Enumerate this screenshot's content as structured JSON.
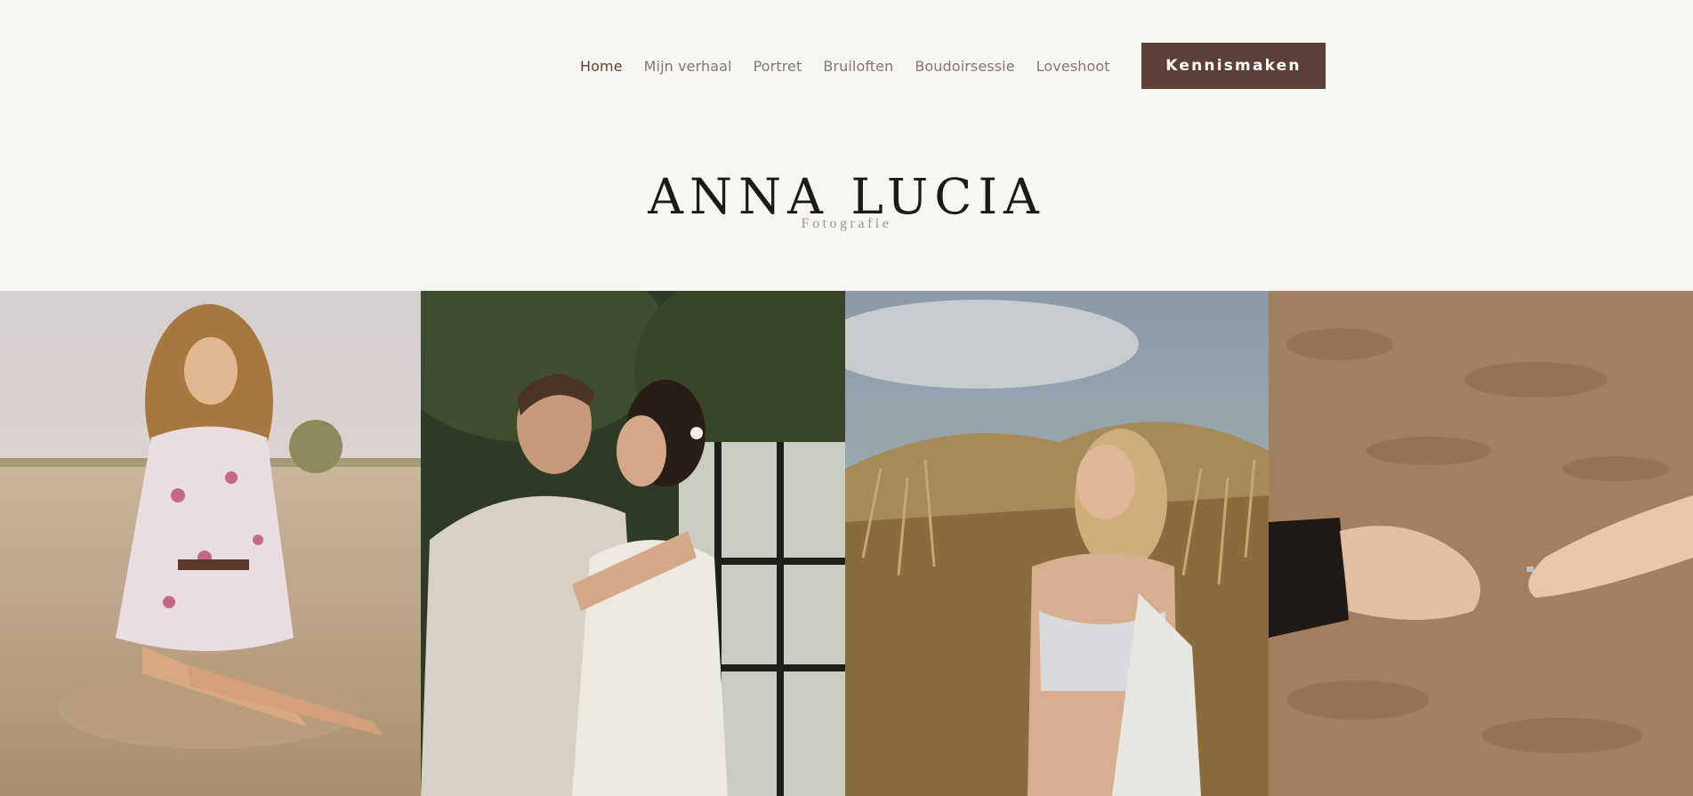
{
  "nav": {
    "items": [
      {
        "label": "Home",
        "active": true
      },
      {
        "label": "Mijn verhaal"
      },
      {
        "label": "Portret"
      },
      {
        "label": "Bruiloften"
      },
      {
        "label": "Boudoirsessie"
      },
      {
        "label": "Loveshoot"
      }
    ],
    "cta_label": "Kennismaken"
  },
  "brand": {
    "name": "ANNA LUCIA",
    "tagline": "Fotografie"
  },
  "colors": {
    "background": "#f8f6f2",
    "accent": "#5d4037",
    "nav_text": "#807872",
    "nav_active": "#5d4037"
  },
  "gallery": [
    {
      "name": "photo-woman-on-beach"
    },
    {
      "name": "photo-wedding-couple"
    },
    {
      "name": "photo-woman-in-dunes"
    },
    {
      "name": "photo-holding-hands"
    }
  ]
}
